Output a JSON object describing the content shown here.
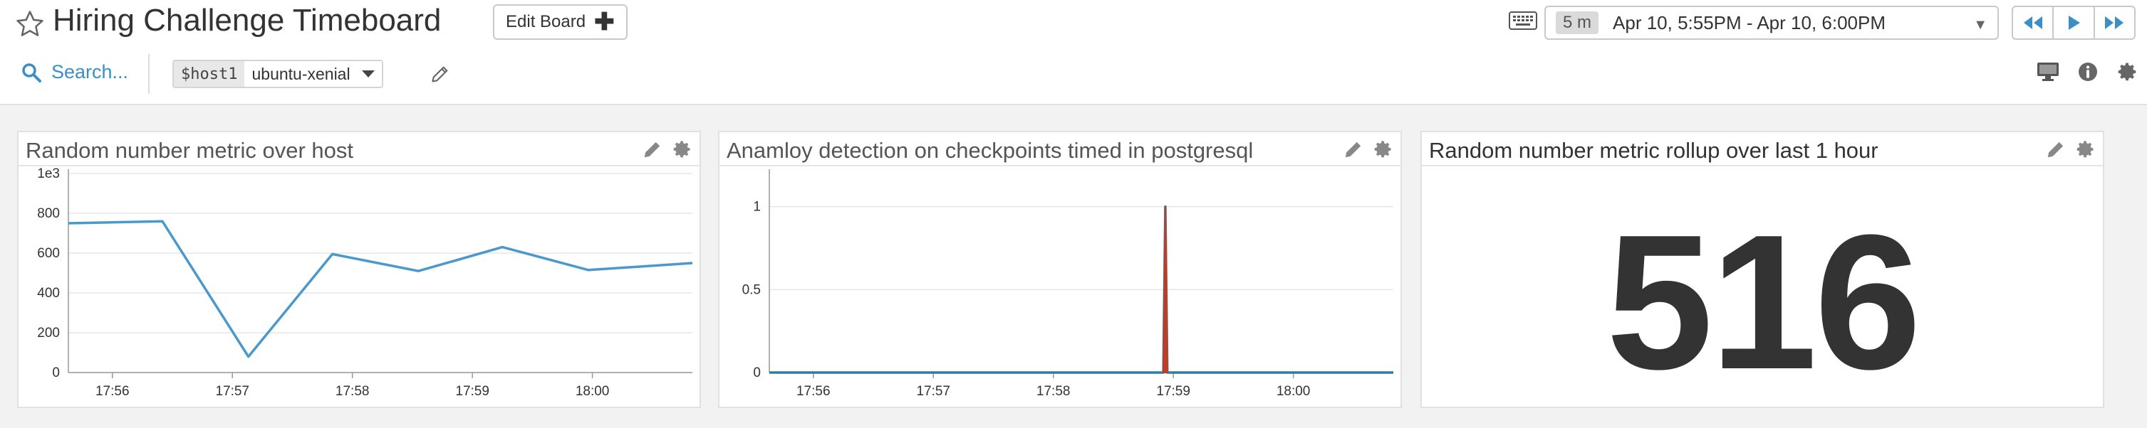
{
  "header": {
    "title": "Hiring Challenge Timeboard",
    "edit_board_label": "Edit Board",
    "time_badge": "5 m",
    "time_range": "Apr 10, 5:55PM - Apr 10, 6:00PM"
  },
  "toolbar": {
    "search_label": "Search...",
    "template_var_name": "$host1",
    "template_var_value": "ubuntu-xenial"
  },
  "colors": {
    "accent": "#3a8fc8",
    "line_blue": "#4a98cc",
    "anomaly_red": "#c23b22",
    "anomaly_teal": "#2a7f9e"
  },
  "icons": [
    "star-icon",
    "plus-icon",
    "keyboard-icon",
    "rewind-icon",
    "play-icon",
    "fast-forward-icon",
    "search-icon",
    "pencil-icon",
    "monitor-icon",
    "info-icon",
    "gear-icon"
  ],
  "panels": [
    {
      "title": "Random number metric over host"
    },
    {
      "title": "Anamloy detection on checkpoints timed in postgresql"
    },
    {
      "title": "Random number metric rollup over last 1 hour",
      "value": "516"
    }
  ],
  "chart_data": [
    {
      "type": "line",
      "title": "Random number metric over host",
      "y_unit_label": "1e3",
      "x_ticks": [
        "17:56",
        "17:57",
        "17:58",
        "17:59",
        "18:00"
      ],
      "y_ticks": [
        "0",
        "200",
        "400",
        "600",
        "800"
      ],
      "ylim": [
        0,
        1000
      ],
      "xlim": [
        "17:55:38",
        "18:00:50"
      ],
      "grid": true,
      "series": [
        {
          "x": [
            "17:55:38",
            "17:56:25",
            "17:57:08",
            "17:57:50",
            "17:58:33",
            "17:59:15",
            "17:59:58",
            "18:00:50"
          ],
          "values": [
            750,
            760,
            80,
            595,
            510,
            630,
            515,
            550
          ]
        }
      ]
    },
    {
      "type": "line",
      "title": "Anamloy detection on checkpoints timed in postgresql",
      "x_ticks": [
        "17:56",
        "17:57",
        "17:58",
        "17:59",
        "18:00"
      ],
      "y_ticks": [
        "0",
        "0.5",
        "1"
      ],
      "ylim": [
        0,
        1.2
      ],
      "xlim": [
        "17:55:38",
        "18:00:50"
      ],
      "grid": true,
      "series": [
        {
          "x": [
            "17:55:38",
            "17:58:55",
            "17:58:56",
            "17:58:57",
            "18:00:50"
          ],
          "values": [
            0,
            0,
            1,
            0,
            0
          ]
        }
      ]
    }
  ]
}
